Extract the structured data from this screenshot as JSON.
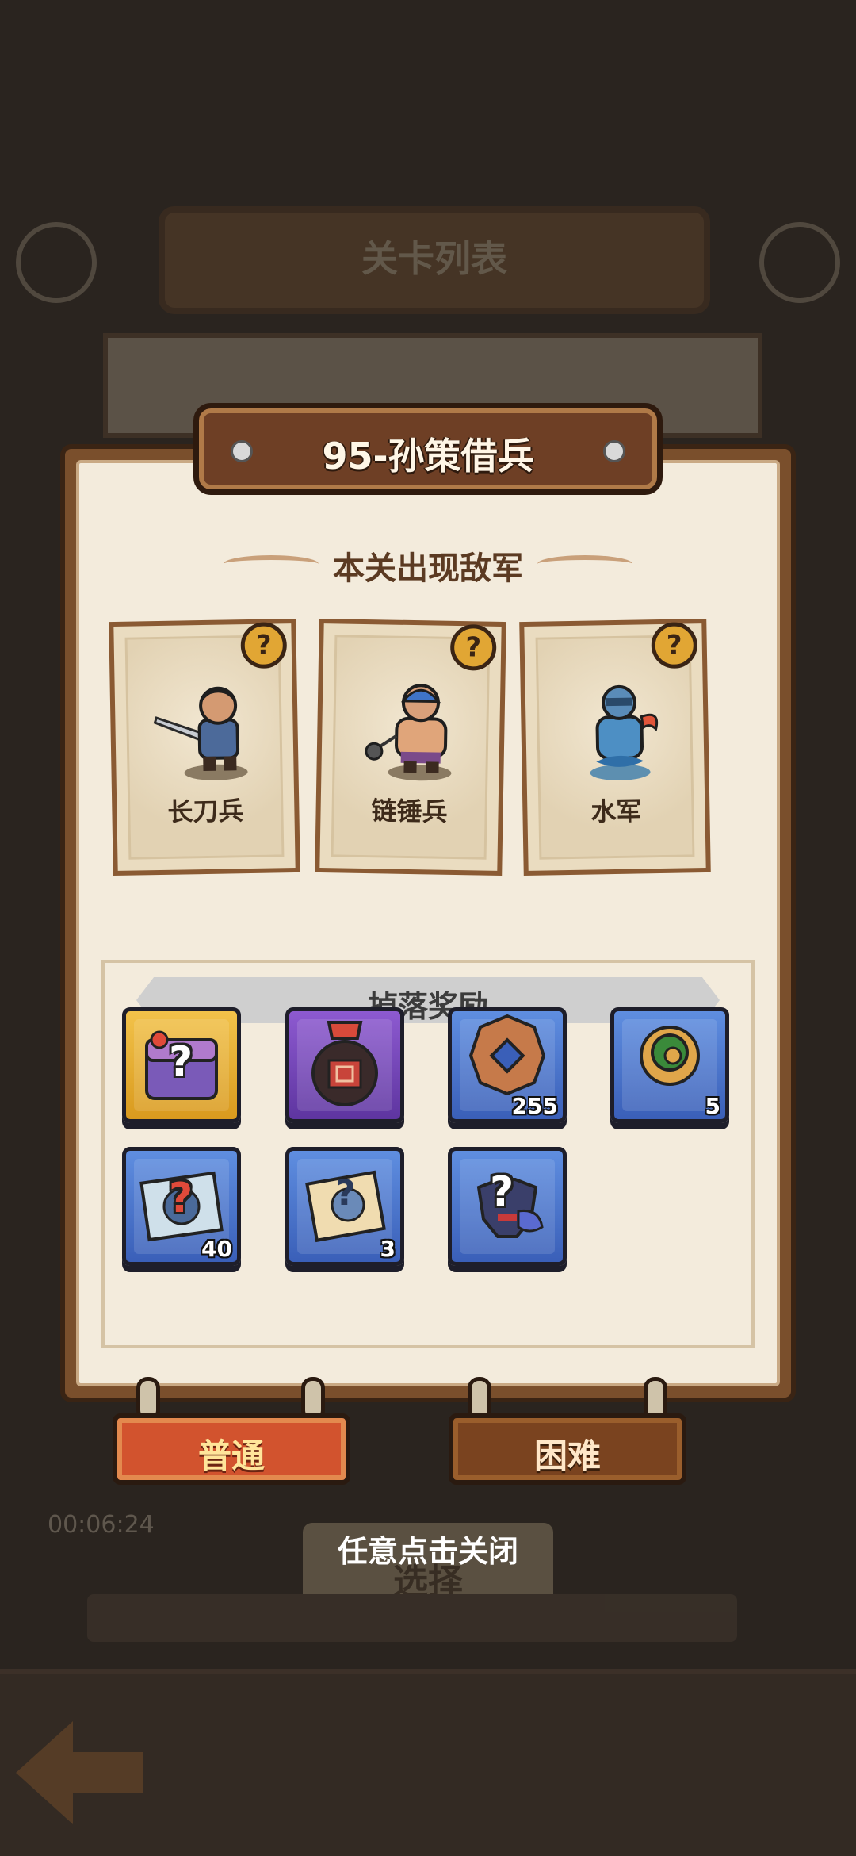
{
  "background": {
    "banner_title": "关卡列表",
    "select_label": "选择",
    "timer": "00:06:24"
  },
  "dialog": {
    "title": "95-孙策借兵",
    "enemies_heading": "本关出现敌军",
    "enemies": [
      {
        "name": "长刀兵",
        "icon": "sword-soldier-icon",
        "badge": "?"
      },
      {
        "name": "链锤兵",
        "icon": "flail-soldier-icon",
        "badge": "?"
      },
      {
        "name": "水军",
        "icon": "water-soldier-icon",
        "badge": "?"
      }
    ],
    "rewards_heading": "掉落奖励",
    "rewards": [
      {
        "icon": "mystery-chest-icon",
        "rarity": "gold",
        "count": "",
        "mark": "?"
      },
      {
        "icon": "wine-jar-icon",
        "rarity": "purple",
        "count": "",
        "mark": ""
      },
      {
        "icon": "copper-coin-icon",
        "rarity": "blue",
        "count": "255",
        "mark": ""
      },
      {
        "icon": "jade-ring-icon",
        "rarity": "blue",
        "count": "5",
        "mark": ""
      },
      {
        "icon": "blue-scroll-icon",
        "rarity": "blue",
        "count": "40",
        "mark": "?"
      },
      {
        "icon": "paper-scroll-icon",
        "rarity": "blue",
        "count": "3",
        "mark": "?"
      },
      {
        "icon": "mystery-armor-icon",
        "rarity": "blue",
        "count": "",
        "mark": "?"
      }
    ],
    "difficulty": {
      "normal_label": "普通",
      "hard_label": "困难",
      "selected": "普通"
    },
    "close_hint": "任意点击关闭"
  },
  "colors": {
    "panel_frame": "#7a4f2c",
    "parchment": "#f3ebdc",
    "normal_button": "#d2532e",
    "hard_button": "#7a431f",
    "rarity_blue": "#3a5fb8",
    "rarity_purple": "#5e35a0",
    "rarity_gold": "#d99a1e"
  }
}
